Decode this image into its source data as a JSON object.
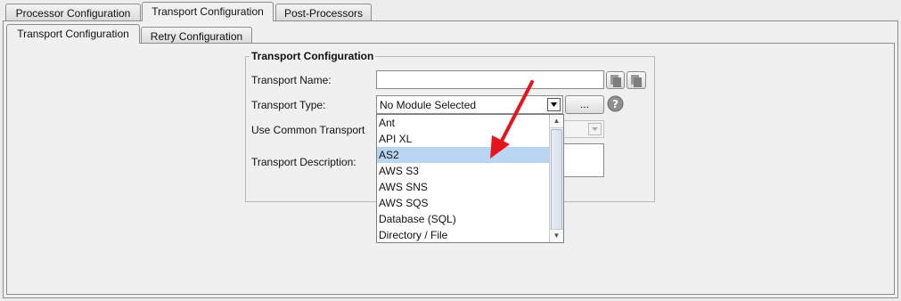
{
  "top_tabs": [
    {
      "label": "Processor Configuration"
    },
    {
      "label": "Transport Configuration"
    },
    {
      "label": "Post-Processors"
    }
  ],
  "sub_tabs": [
    {
      "label": "Transport Configuration"
    },
    {
      "label": "Retry Configuration"
    }
  ],
  "group": {
    "title": "Transport Configuration",
    "name_label": "Transport Name:",
    "name_value": "",
    "type_label": "Transport Type:",
    "type_selected": "No Module Selected",
    "ellipsis_label": "...",
    "common_label": "Use Common Transport",
    "description_label": "Transport Description:"
  },
  "dropdown": {
    "options": [
      "Ant",
      "API XL",
      "AS2",
      "AWS S3",
      "AWS SNS",
      "AWS SQS",
      "Database (SQL)",
      "Directory / File"
    ],
    "highlighted": "AS2"
  },
  "colors": {
    "arrow": "#e8141b",
    "selection": "#b8d6f2"
  }
}
